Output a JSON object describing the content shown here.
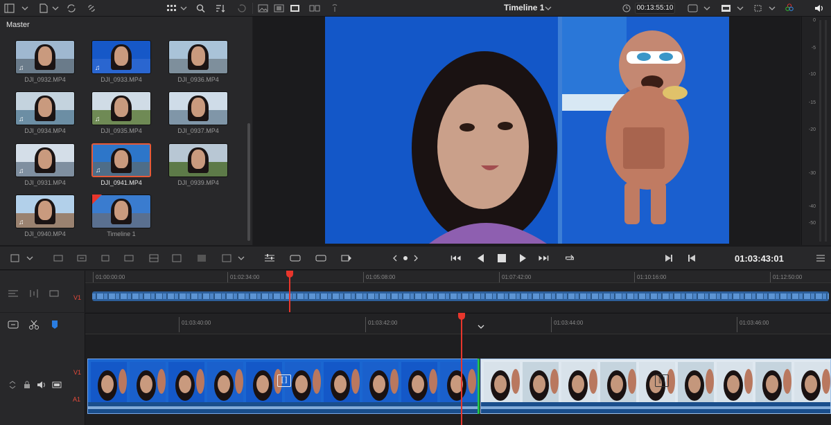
{
  "media_pool": {
    "title": "Master",
    "clips": [
      {
        "name": "DJI_0932.MP4",
        "audio": true,
        "selected": false
      },
      {
        "name": "DJI_0933.MP4",
        "audio": true,
        "selected": false
      },
      {
        "name": "DJI_0936.MP4",
        "audio": false,
        "selected": false
      },
      {
        "name": "DJI_0934.MP4",
        "audio": true,
        "selected": false
      },
      {
        "name": "DJI_0935.MP4",
        "audio": true,
        "selected": false
      },
      {
        "name": "DJI_0937.MP4",
        "audio": false,
        "selected": false
      },
      {
        "name": "DJI_0931.MP4",
        "audio": true,
        "selected": false
      },
      {
        "name": "DJI_0941.MP4",
        "audio": true,
        "selected": true
      },
      {
        "name": "DJI_0939.MP4",
        "audio": false,
        "selected": false
      },
      {
        "name": "DJI_0940.MP4",
        "audio": true,
        "selected": false
      },
      {
        "name": "Timeline 1",
        "audio": false,
        "selected": false
      }
    ]
  },
  "viewer": {
    "timeline_name": "Timeline 1",
    "duration_tc": "00:13:55:10",
    "current_tc": "01:03:43:01"
  },
  "meters": {
    "labels": [
      "0",
      "-5",
      "-10",
      "-15",
      "-20",
      "-30",
      "-40",
      "-50"
    ]
  },
  "upper_ruler": {
    "labels": [
      "01:00:00:00",
      "01:02:34:00",
      "01:05:08:00",
      "01:07:42:00",
      "01:10:16:00",
      "01:12:50:00"
    ]
  },
  "lower_ruler": {
    "labels": [
      "01:03:40:00",
      "01:03:42:00",
      "01:03:44:00",
      "01:03:46:00"
    ]
  },
  "tracks": {
    "upper_v": "V1",
    "video": "V1",
    "audio": "A1"
  },
  "colors": {
    "accent_red": "#e8362c",
    "clip_blue": "#1a66d1",
    "selection": "#e85a38"
  }
}
